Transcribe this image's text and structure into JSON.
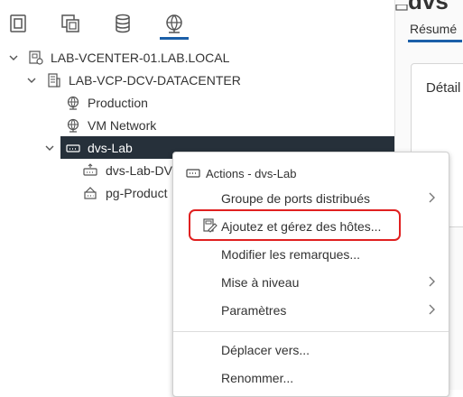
{
  "nav_tabs": [
    {
      "name": "hosts-clusters",
      "icon": "hosts-and-clusters-icon",
      "active": false
    },
    {
      "name": "vms-templates",
      "icon": "vms-and-templates-icon",
      "active": false
    },
    {
      "name": "storage",
      "icon": "storage-icon",
      "active": false
    },
    {
      "name": "networking",
      "icon": "networking-icon",
      "active": true
    }
  ],
  "tree": {
    "vcenter": "LAB-VCENTER-01.LAB.LOCAL",
    "datacenter": "LAB-VCP-DCV-DATACENTER",
    "production": "Production",
    "vm_network": "VM Network",
    "dvs": "dvs-Lab",
    "dvs_uplinks": "dvs-Lab-DV",
    "pg_production": "pg-Product"
  },
  "right_pane": {
    "title": "dvs",
    "tab": "Résumé",
    "card_title": "Détail"
  },
  "context_menu": {
    "header": "Actions - dvs-Lab",
    "items": [
      {
        "label": "Groupe de ports distribués",
        "submenu": true
      },
      {
        "label": "Ajoutez et gérez des hôtes...",
        "submenu": false,
        "highlighted": true
      },
      {
        "label": "Modifier les remarques...",
        "submenu": false
      },
      {
        "label": "Mise à niveau",
        "submenu": true
      },
      {
        "label": "Paramètres",
        "submenu": true
      },
      {
        "label": "Déplacer vers...",
        "submenu": false
      },
      {
        "label": "Renommer...",
        "submenu": false
      }
    ]
  },
  "colors": {
    "selected_row_bg": "#26303a",
    "accent": "#1b5fa8",
    "highlight_border": "#e02020"
  }
}
